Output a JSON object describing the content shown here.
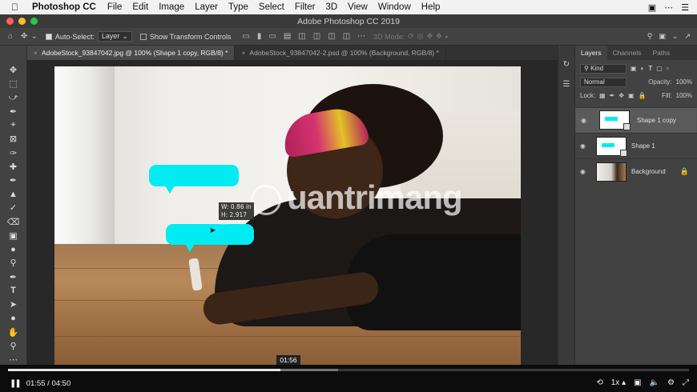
{
  "menubar": {
    "app_name": "Photoshop CC",
    "items": [
      "File",
      "Edit",
      "Image",
      "Layer",
      "Type",
      "Select",
      "Filter",
      "3D",
      "View",
      "Window",
      "Help"
    ],
    "right_icons": [
      "screen-icon",
      "dots-icon",
      "list-icon"
    ]
  },
  "window": {
    "title": "Adobe Photoshop CC 2019"
  },
  "options_bar": {
    "auto_select_label": "Auto-Select:",
    "auto_select_value": "Layer",
    "transform_label": "Show Transform Controls",
    "mode_label": "3D Mode:"
  },
  "tabs": [
    {
      "label": "AdobeStock_93847042.jpg @ 100% (Shape 1 copy, RGB/8) *",
      "active": true
    },
    {
      "label": "AdobeStock_93847042-2.psd @ 100% (Background, RGB/8) *",
      "active": false
    }
  ],
  "canvas": {
    "measure_line1": "W: 0.86 in",
    "measure_line2": "H: 2.917 in",
    "watermark": "uantrimang",
    "bubble_color": "#00ecf2"
  },
  "layers_panel": {
    "tabs": [
      "Layers",
      "Channels",
      "Paths"
    ],
    "filter_kind": "Kind",
    "blend_mode": "Normal",
    "opacity_label": "Opacity:",
    "opacity_value": "100%",
    "lock_label": "Lock:",
    "fill_label": "Fill:",
    "fill_value": "100%",
    "layers": [
      {
        "name": "Shape 1 copy",
        "selected": true
      },
      {
        "name": "Shape 1",
        "selected": false
      },
      {
        "name": "Background",
        "selected": false
      }
    ]
  },
  "player": {
    "current_time": "01:55",
    "total_time": "04:50",
    "hover_time": "01:56",
    "speed": "1x",
    "progress_percent": 40
  }
}
